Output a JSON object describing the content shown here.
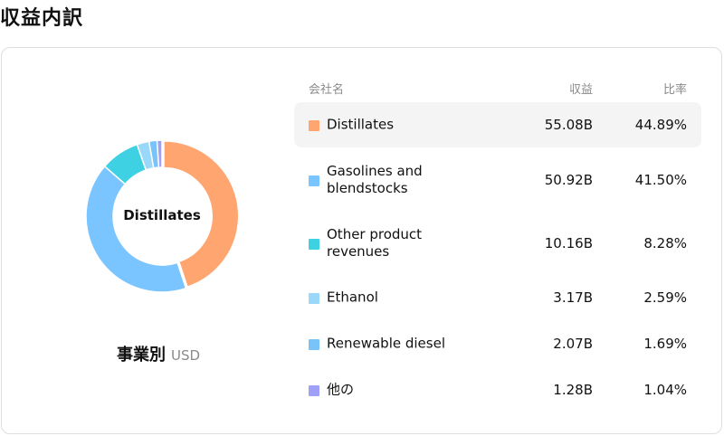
{
  "page_title": "収益内訳",
  "center_label": "Distillates",
  "caption": {
    "main": "事業別",
    "sub": "USD"
  },
  "table": {
    "headers": {
      "name": "会社名",
      "revenue": "収益",
      "ratio": "比率"
    },
    "rows": [
      {
        "name": "Distillates",
        "revenue": "55.08B",
        "ratio": "44.89%",
        "color": "#FFA570",
        "active": true
      },
      {
        "name": "Gasolines and blendstocks",
        "revenue": "50.92B",
        "ratio": "41.50%",
        "color": "#7AC4FF",
        "active": false
      },
      {
        "name": "Other product revenues",
        "revenue": "10.16B",
        "ratio": "8.28%",
        "color": "#3ED0E3",
        "active": false
      },
      {
        "name": "Ethanol",
        "revenue": "3.17B",
        "ratio": "2.59%",
        "color": "#9AD8FA",
        "active": false
      },
      {
        "name": "Renewable diesel",
        "revenue": "2.07B",
        "ratio": "1.69%",
        "color": "#78C3F8",
        "active": false
      },
      {
        "name": "他の",
        "revenue": "1.28B",
        "ratio": "1.04%",
        "color": "#A0A0F8",
        "active": false
      }
    ]
  },
  "chart_data": {
    "type": "pie",
    "variant": "donut",
    "categories": [
      "Distillates",
      "Gasolines and blendstocks",
      "Other product revenues",
      "Ethanol",
      "Renewable diesel",
      "他の"
    ],
    "values": [
      55.08,
      50.92,
      10.16,
      3.17,
      2.07,
      1.28
    ],
    "percentages": [
      44.89,
      41.5,
      8.28,
      2.59,
      1.69,
      1.04
    ],
    "unit": "B USD",
    "colors": [
      "#FFA570",
      "#7AC4FF",
      "#3ED0E3",
      "#9AD8FA",
      "#78C3F8",
      "#A0A0F8"
    ],
    "highlighted": "Distillates"
  }
}
